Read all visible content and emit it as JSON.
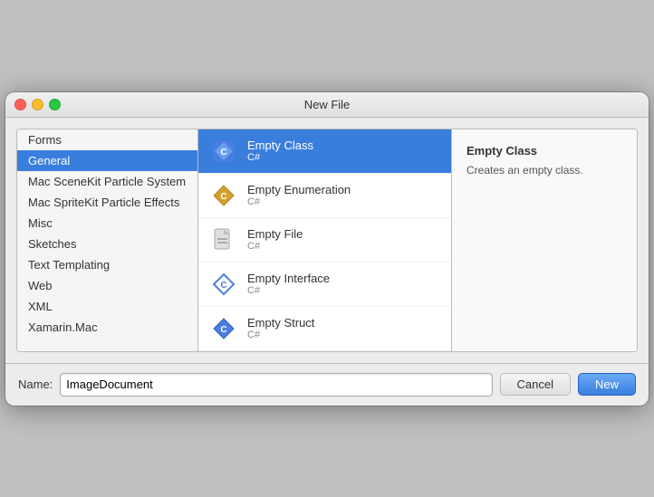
{
  "window": {
    "title": "New File"
  },
  "sidebar": {
    "items": [
      {
        "id": "forms",
        "label": "Forms"
      },
      {
        "id": "general",
        "label": "General",
        "selected": true
      },
      {
        "id": "mac-scenekit",
        "label": "Mac SceneKit Particle System"
      },
      {
        "id": "mac-spritekit",
        "label": "Mac SpriteKit Particle Effects"
      },
      {
        "id": "misc",
        "label": "Misc"
      },
      {
        "id": "sketches",
        "label": "Sketches"
      },
      {
        "id": "text-templating",
        "label": "Text Templating"
      },
      {
        "id": "web",
        "label": "Web"
      },
      {
        "id": "xml",
        "label": "XML"
      },
      {
        "id": "xamarin-mac",
        "label": "Xamarin.Mac"
      }
    ]
  },
  "file_list": {
    "items": [
      {
        "id": "empty-class",
        "name": "Empty Class",
        "sub": "C#",
        "selected": true,
        "icon_type": "diamond_blue"
      },
      {
        "id": "empty-enumeration",
        "name": "Empty Enumeration",
        "sub": "C#",
        "selected": false,
        "icon_type": "diamond_orange"
      },
      {
        "id": "empty-file",
        "name": "Empty File",
        "sub": "C#",
        "selected": false,
        "icon_type": "doc_gray"
      },
      {
        "id": "empty-interface",
        "name": "Empty Interface",
        "sub": "C#",
        "selected": false,
        "icon_type": "diamond_blue_outline"
      },
      {
        "id": "empty-struct",
        "name": "Empty Struct",
        "sub": "C#",
        "selected": false,
        "icon_type": "diamond_blue2"
      }
    ]
  },
  "detail": {
    "title": "Empty Class",
    "description": "Creates an empty class."
  },
  "bottom": {
    "name_label": "Name:",
    "name_value": "ImageDocument",
    "name_placeholder": "Name"
  },
  "buttons": {
    "cancel": "Cancel",
    "new": "New"
  },
  "colors": {
    "selected_blue": "#3a7edd",
    "icon_blue": "#4a7edd",
    "icon_orange": "#d4a030"
  }
}
